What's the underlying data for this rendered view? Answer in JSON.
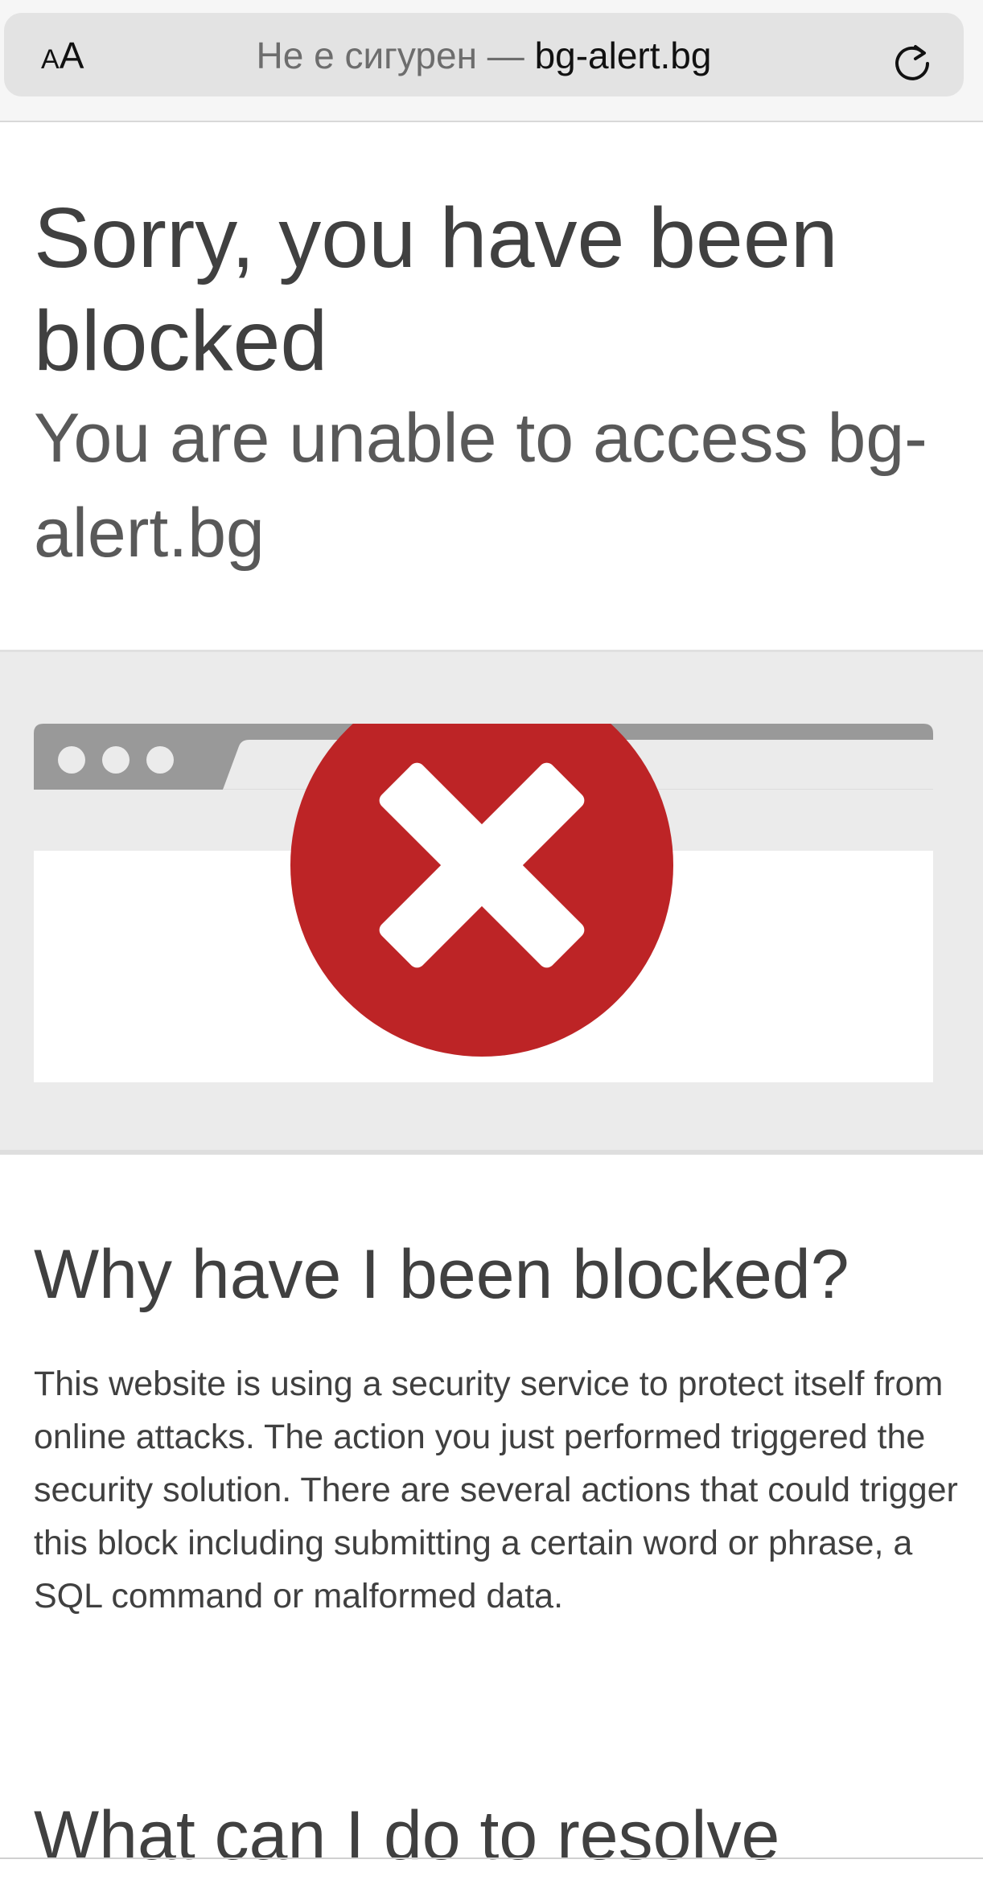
{
  "browser": {
    "text_size_small": "A",
    "text_size_big": "A",
    "insecure_label": "Не е сигурен —",
    "domain": "bg-alert.bg"
  },
  "page": {
    "title": "Sorry, you have been blocked",
    "subtitle": "You are unable to access bg-alert.bg",
    "why_heading": "Why have I been blocked?",
    "why_text": "This website is using a security service to protect itself from online attacks. The action you just performed triggered the security solution. There are several actions that could trigger this block including submitting a certain word or phrase, a SQL command or malformed data.",
    "resolve_heading": "What can I do to resolve"
  },
  "colors": {
    "error_red": "#bd2426",
    "tab_gray": "#999999",
    "band_gray": "#ebebeb"
  },
  "icons": [
    "text-size-icon",
    "reload-icon",
    "blocked-x-icon"
  ]
}
